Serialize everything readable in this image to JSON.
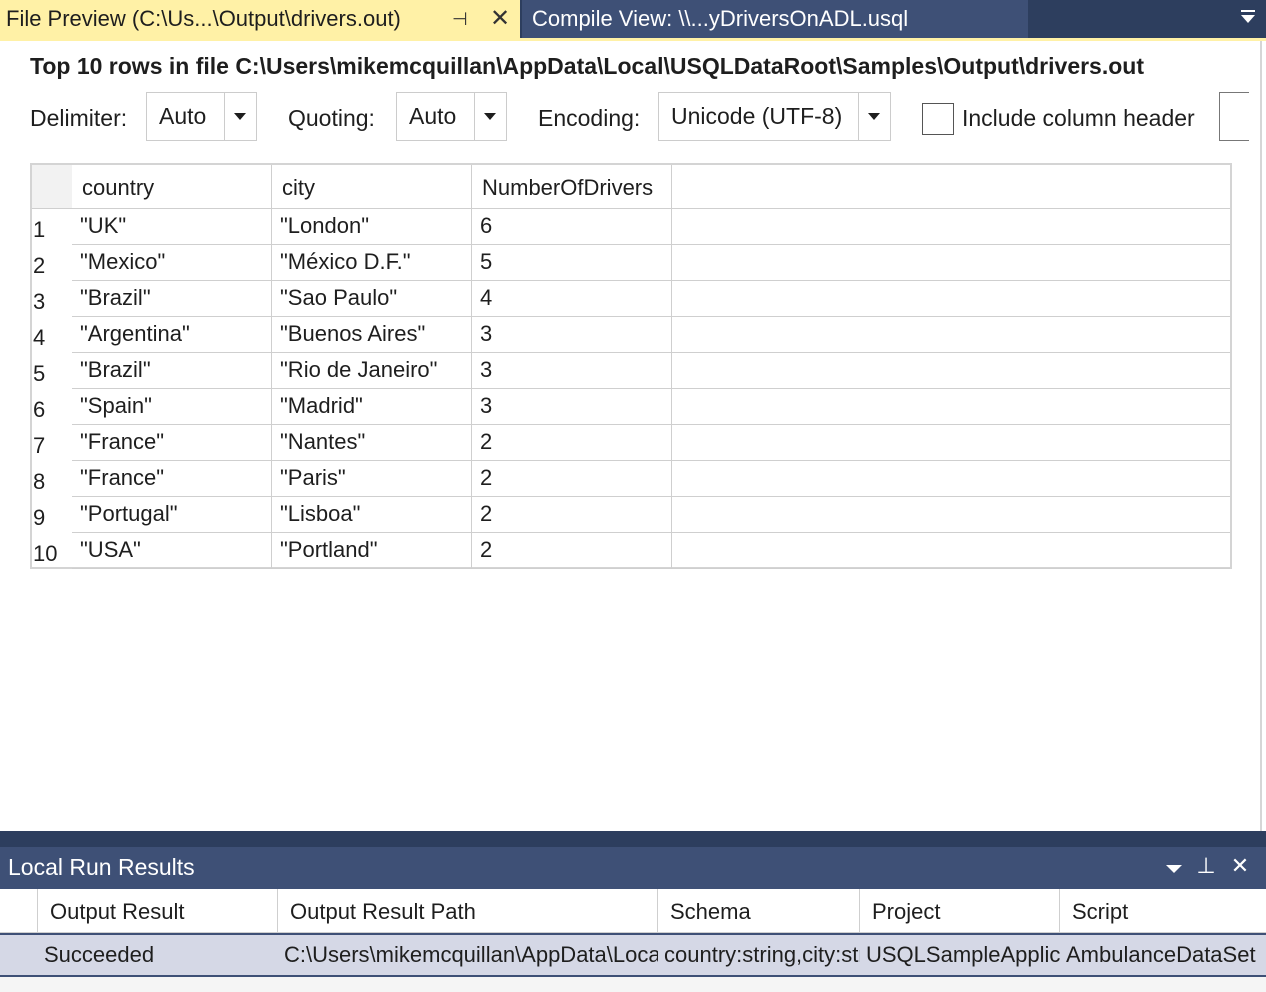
{
  "tabs": {
    "active": {
      "title": "File Preview (C:\\Us...\\Output\\drivers.out)",
      "pin_glyph": "⊣",
      "close_glyph": "✕"
    },
    "inactive": {
      "title": "Compile View:  \\\\...yDriversOnADL.usql"
    }
  },
  "preview": {
    "title": "Top 10 rows in file C:\\Users\\mikemcquillan\\AppData\\Local\\USQLDataRoot\\Samples\\Output\\drivers.out",
    "delimiter": {
      "label": "Delimiter:",
      "value": "Auto"
    },
    "quoting": {
      "label": "Quoting:",
      "value": "Auto"
    },
    "encoding": {
      "label": "Encoding:",
      "value": "Unicode (UTF-8)"
    },
    "include_header": {
      "label": "Include column header",
      "checked": false
    }
  },
  "grid": {
    "columns": [
      "country",
      "city",
      "NumberOfDrivers"
    ],
    "rows": [
      {
        "num": "1",
        "country": "\"UK\"",
        "city": "\"London\"",
        "drivers": "6"
      },
      {
        "num": "2",
        "country": "\"Mexico\"",
        "city": "\"México D.F.\"",
        "drivers": "5"
      },
      {
        "num": "3",
        "country": "\"Brazil\"",
        "city": "\"Sao Paulo\"",
        "drivers": "4"
      },
      {
        "num": "4",
        "country": "\"Argentina\"",
        "city": "\"Buenos Aires\"",
        "drivers": "3"
      },
      {
        "num": "5",
        "country": "\"Brazil\"",
        "city": "\"Rio de Janeiro\"",
        "drivers": "3"
      },
      {
        "num": "6",
        "country": "\"Spain\"",
        "city": "\"Madrid\"",
        "drivers": "3"
      },
      {
        "num": "7",
        "country": "\"France\"",
        "city": "\"Nantes\"",
        "drivers": "2"
      },
      {
        "num": "8",
        "country": "\"France\"",
        "city": "\"Paris\"",
        "drivers": "2"
      },
      {
        "num": "9",
        "country": "\"Portugal\"",
        "city": "\"Lisboa\"",
        "drivers": "2"
      },
      {
        "num": "10",
        "country": "\"USA\"",
        "city": "\"Portland\"",
        "drivers": "2"
      }
    ]
  },
  "results": {
    "title": "Local Run Results",
    "pin_glyph": "⊥",
    "close_glyph": "✕",
    "columns": [
      "Output Result",
      "Output Result Path",
      "Schema",
      "Project",
      "Script"
    ],
    "row": {
      "output_result": "Succeeded",
      "output_result_path": "C:\\Users\\mikemcquillan\\AppData\\Local\\USQLDataRoot",
      "schema": "country:string,city:string",
      "project": "USQLSampleApplication",
      "script": "AmbulanceDataSet"
    }
  },
  "colors": {
    "active_tab": "#fff1a6",
    "chrome": "#2d3e5e",
    "panel_header": "#3e5076",
    "selected_row": "#d5d8e6"
  },
  "icons": {
    "tab_pin": "pin-icon",
    "tab_close": "close-icon",
    "tab_overflow": "tab-overflow-dropdown-icon",
    "combo_arrow": "chevron-down-icon",
    "results_dropdown": "window-position-dropdown-icon",
    "results_pin": "pin-icon",
    "results_close": "close-icon"
  }
}
